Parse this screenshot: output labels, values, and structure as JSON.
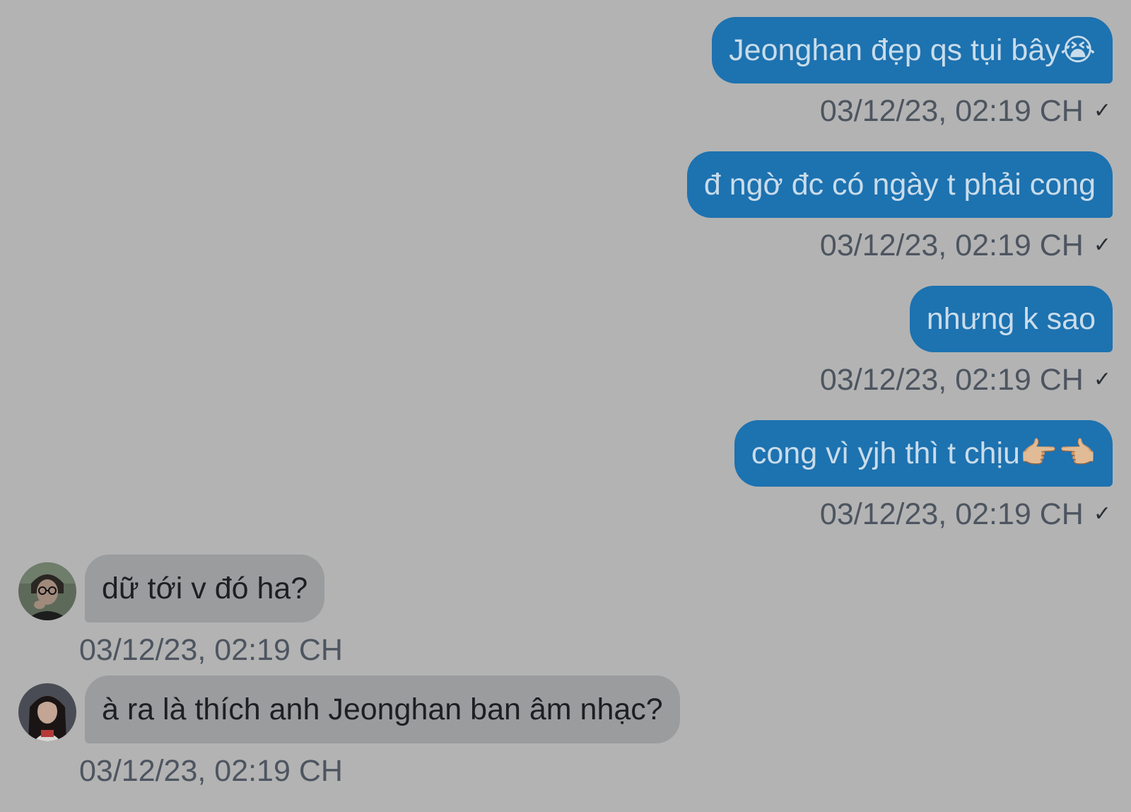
{
  "colors": {
    "background": "#b3b3b3",
    "sent_bubble": "#1d72b0",
    "sent_text": "#c9dcea",
    "received_bubble": "#9a9c9e",
    "received_text": "#1d1f22",
    "timestamp": "#4d5560"
  },
  "messages": [
    {
      "direction": "sent",
      "text": "Jeonghan đẹp qs tụi bây😭",
      "time": "03/12/23, 02:19 CH",
      "status": "✓"
    },
    {
      "direction": "sent",
      "text": "đ ngờ đc có ngày t phải cong",
      "time": "03/12/23, 02:19 CH",
      "status": "✓"
    },
    {
      "direction": "sent",
      "text": "nhưng k sao",
      "time": "03/12/23, 02:19 CH",
      "status": "✓"
    },
    {
      "direction": "sent",
      "text": "cong vì yjh thì t chịu👉🏼👈🏼",
      "time": "03/12/23, 02:19 CH",
      "status": "✓"
    },
    {
      "direction": "received",
      "text": "dữ tới v đó ha?",
      "time": "03/12/23, 02:19 CH",
      "avatar": "avatar-user-glasses"
    },
    {
      "direction": "received",
      "text": "à ra là thích anh Jeonghan ban âm nhạc?",
      "time": "03/12/23, 02:19 CH",
      "avatar": "avatar-user-long-hair"
    }
  ]
}
